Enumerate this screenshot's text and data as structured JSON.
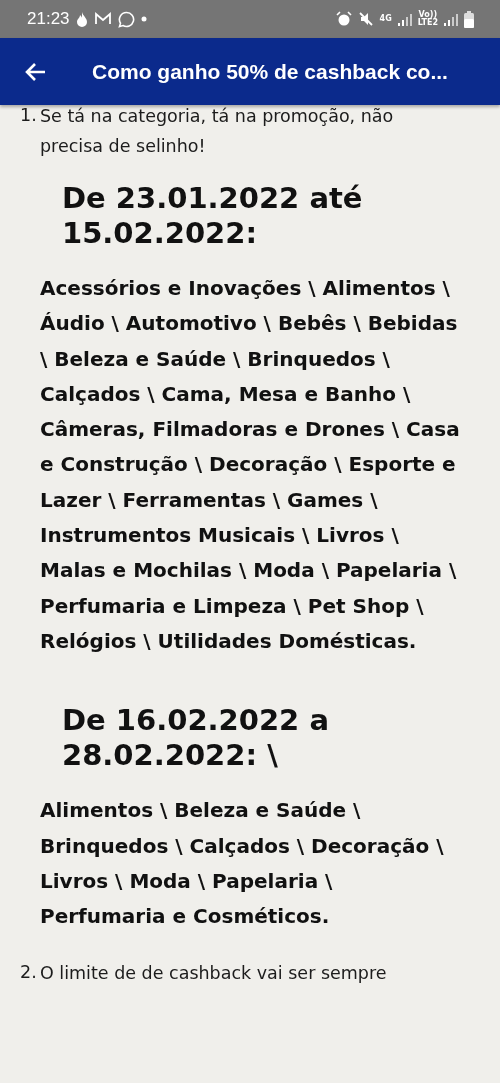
{
  "status_bar": {
    "time": "21:23",
    "network": "4G",
    "volte": "Vo))",
    "lte": "LTE2"
  },
  "app_bar": {
    "title": "Como ganho 50% de cashback co..."
  },
  "list": [
    {
      "number": "1.",
      "text": "Se tá na categoria, tá na promoção, não precisa de selinho!",
      "sections": [
        {
          "heading": "De 23.01.2022 até 15.02.2022:",
          "categories": "Acessórios e Inovações \\ Alimentos \\ Áudio \\ Automotivo \\ Bebês \\ Bebidas \\ Beleza e Saúde \\ Brinquedos \\ Calçados \\ Cama, Mesa e Banho \\ Câmeras, Filmadoras e Drones \\ Casa e Construção \\ Decoração \\ Esporte e Lazer \\ Ferramentas \\ Games \\ Instrumentos Musicais \\ Livros \\ Malas e Mochilas \\ Moda \\ Papelaria \\ Perfumaria e Limpeza \\ Pet Shop \\ Relógios \\ Utilidades Domésticas."
        },
        {
          "heading": "De 16.02.2022 a 28.02.2022: \\",
          "categories": "Alimentos \\ Beleza e Saúde \\ Brinquedos \\ Calçados \\ Decoração \\ Livros \\ Moda \\ Papelaria \\ Perfumaria e Cosméticos."
        }
      ]
    },
    {
      "number": "2.",
      "text": "O limite de de cashback vai ser sempre"
    }
  ]
}
